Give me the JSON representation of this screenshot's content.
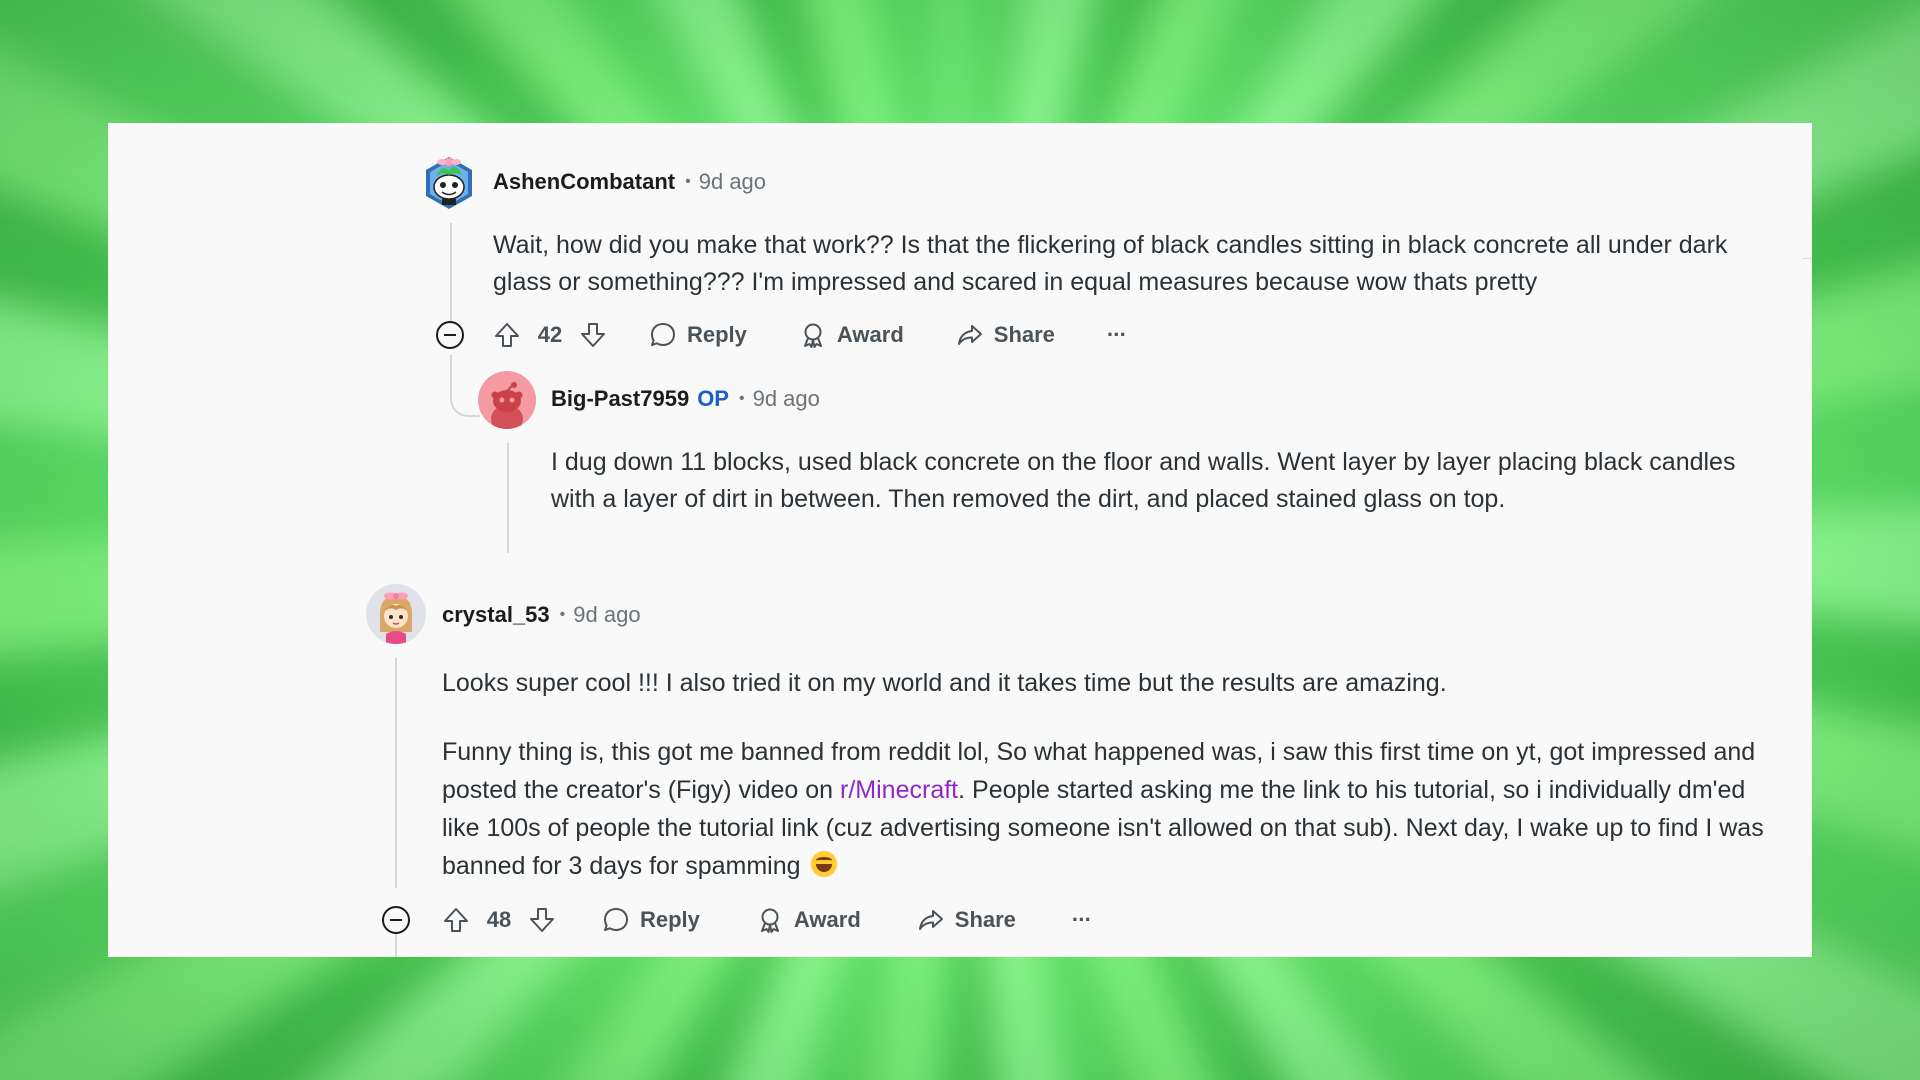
{
  "comments": [
    {
      "author": "AshenCombatant",
      "time": "9d ago",
      "body": "Wait, how did you make that work?? Is that the flickering of black candles sitting in black concrete all under dark glass or something??? I'm impressed and scared in equal measures because wow thats pretty",
      "votes": "42",
      "reply_label": "Reply",
      "award_label": "Award",
      "share_label": "Share",
      "more_label": "···"
    },
    {
      "author": "Big-Past7959",
      "op_badge": "OP",
      "time": "9d ago",
      "body": "I dug down 11 blocks, used black concrete on the floor and walls. Went layer by layer placing black candles with a layer of dirt in between. Then removed the dirt, and placed stained glass on top."
    },
    {
      "author": "crystal_53",
      "time": "9d ago",
      "body_p1": "Looks super cool !!! I also tried it on my world and it takes time but the results are amazing.",
      "body_p2_before": "Funny thing is, this got me banned from reddit lol, So what happened was, i saw this first time on yt, got impressed and posted the creator's (Figy) video on ",
      "body_p2_link": "r/Minecraft",
      "body_p2_after": ". People started asking me the link to his tutorial, so i individually dm'ed like 100s of people the tutorial link (cuz advertising someone isn't allowed on that sub). Next day, I wake up to find I was banned for 3 days for spamming ",
      "votes": "48",
      "reply_label": "Reply",
      "award_label": "Award",
      "share_label": "Share",
      "more_label": "···"
    }
  ],
  "icons": {
    "collapse": "minus-circle-icon",
    "upvote": "arrow-up-icon",
    "downvote": "arrow-down-icon",
    "reply": "speech-bubble-icon",
    "award": "award-ribbon-icon",
    "share": "share-arrow-icon",
    "more": "ellipsis-icon",
    "emoji": "laughing-emoji-icon"
  },
  "colors": {
    "background": "#6fe878",
    "card": "#f9f9fa",
    "op_badge": "#1a60c8",
    "link": "#8d2ac4",
    "thread_line": "#d3d6da"
  }
}
